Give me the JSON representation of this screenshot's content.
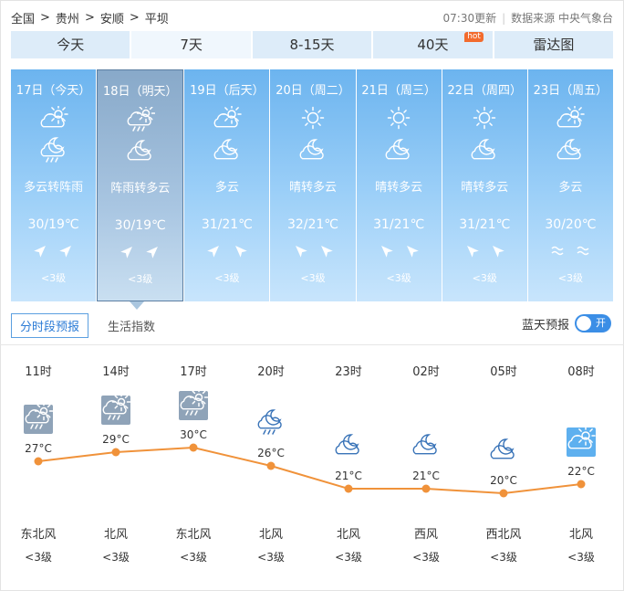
{
  "breadcrumb": {
    "items": [
      "全国",
      "贵州",
      "安顺",
      "平坝"
    ],
    "sep": ">"
  },
  "meta": {
    "updated": "07:30更新",
    "source": "数据来源 中央气象台"
  },
  "tabs": [
    {
      "label": "今天"
    },
    {
      "label": "7天",
      "active": true
    },
    {
      "label": "8-15天"
    },
    {
      "label": "40天",
      "badge": "hot"
    },
    {
      "label": "雷达图"
    }
  ],
  "days": [
    {
      "date": "17日（今天）",
      "icon_day": "partly-cloudy-icon",
      "icon_night": "night-shower-icon",
      "desc": "多云转阵雨",
      "temp": "30/19℃",
      "wind": [
        "northeast-arrow-icon",
        "northeast-arrow-icon"
      ],
      "level": "<3级",
      "selected": false
    },
    {
      "date": "18日（明天）",
      "icon_day": "shower-icon",
      "icon_night": "night-cloudy-icon",
      "desc": "阵雨转多云",
      "temp": "30/19℃",
      "wind": [
        "northeast-arrow-icon",
        "northeast-arrow-icon"
      ],
      "level": "<3级",
      "selected": true
    },
    {
      "date": "19日（后天）",
      "icon_day": "partly-cloudy-icon",
      "icon_night": "night-cloudy-icon",
      "desc": "多云",
      "temp": "31/21℃",
      "wind": [
        "northeast-arrow-icon",
        "northwest-arrow-icon"
      ],
      "level": "<3级",
      "selected": false
    },
    {
      "date": "20日（周二）",
      "icon_day": "sunny-icon",
      "icon_night": "night-cloudy-icon",
      "desc": "晴转多云",
      "temp": "32/21℃",
      "wind": [
        "northwest-arrow-icon",
        "northwest-arrow-icon"
      ],
      "level": "<3级",
      "selected": false
    },
    {
      "date": "21日（周三）",
      "icon_day": "sunny-icon",
      "icon_night": "night-cloudy-icon",
      "desc": "晴转多云",
      "temp": "31/21℃",
      "wind": [
        "northwest-arrow-icon",
        "northwest-arrow-icon"
      ],
      "level": "<3级",
      "selected": false
    },
    {
      "date": "22日（周四）",
      "icon_day": "sunny-icon",
      "icon_night": "night-cloudy-icon",
      "desc": "晴转多云",
      "temp": "31/21℃",
      "wind": [
        "northwest-arrow-icon",
        "northwest-arrow-icon"
      ],
      "level": "<3级",
      "selected": false
    },
    {
      "date": "23日（周五）",
      "icon_day": "partly-cloudy-icon",
      "icon_night": "night-cloudy-icon",
      "desc": "多云",
      "temp": "30/20℃",
      "wind": [
        "variable-wind-icon",
        "variable-wind-icon"
      ],
      "level": "<3级",
      "selected": false
    }
  ],
  "subtabs": {
    "active": "分时段预报",
    "other": "生活指数"
  },
  "bluesky": {
    "label": "蓝天预报",
    "toggle": "开",
    "on": true
  },
  "chart_data": {
    "type": "line",
    "x": [
      "11时",
      "14时",
      "17时",
      "20时",
      "23时",
      "02时",
      "05时",
      "08时"
    ],
    "series": [
      {
        "values": [
          27,
          29,
          30,
          26,
          21,
          21,
          20,
          22
        ]
      }
    ],
    "point_labels": [
      "27°C",
      "29°C",
      "30°C",
      "26°C",
      "21°C",
      "21°C",
      "20°C",
      "22°C"
    ],
    "icons": [
      "shower-icon",
      "shower-icon",
      "shower-icon",
      "night-shower-icon",
      "night-cloudy-icon",
      "night-cloudy-icon",
      "night-cloudy-icon",
      "partly-cloudy-icon"
    ],
    "wind_dir": [
      "东北风",
      "北风",
      "东北风",
      "北风",
      "北风",
      "西风",
      "西北风",
      "北风"
    ],
    "wind_level": [
      "<3级",
      "<3级",
      "<3级",
      "<3级",
      "<3级",
      "<3级",
      "<3级",
      "<3级"
    ],
    "line_color": "#f0923a"
  }
}
